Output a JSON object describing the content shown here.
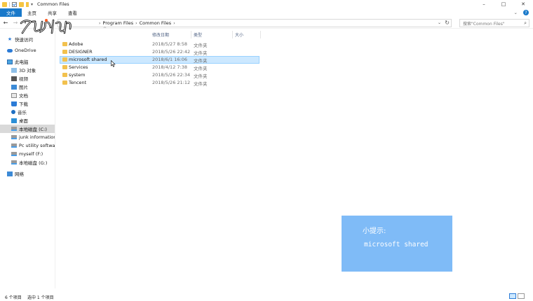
{
  "window": {
    "title": "Common Files",
    "controls": [
      "–",
      "□",
      "✕"
    ]
  },
  "ribbon": {
    "tabs": [
      "文件",
      "主页",
      "共享",
      "查看"
    ]
  },
  "address": {
    "crumbs": [
      "Program Files",
      "Common Files"
    ],
    "search_placeholder": "搜索\"Common Files\""
  },
  "columns": {
    "date": "修改日期",
    "type": "类型",
    "size": "大小"
  },
  "nav": {
    "quick_access": "快速访问",
    "onedrive": "OneDrive",
    "this_pc": "此电脑",
    "objects3d": "3D 对象",
    "videos": "视频",
    "pictures": "图片",
    "documents": "文档",
    "downloads": "下载",
    "music": "音乐",
    "desktop": "桌面",
    "drive_c": "本地磁盘 (C:)",
    "drive_junk": "junk information (",
    "drive_pc": "Pc  utility software",
    "drive_f": "myself (F:)",
    "drive_g": "本地磁盘 (G:)",
    "network": "网络"
  },
  "files": [
    {
      "name": "Adobe",
      "date": "2018/5/27 8:58",
      "type": "文件夹"
    },
    {
      "name": "DESIGNER",
      "date": "2018/5/26 22:42",
      "type": "文件夹"
    },
    {
      "name": "microsoft shared",
      "date": "2018/6/1 16:06",
      "type": "文件夹",
      "selected": true
    },
    {
      "name": "Services",
      "date": "2018/4/12 7:38",
      "type": "文件夹"
    },
    {
      "name": "system",
      "date": "2018/5/26 22:34",
      "type": "文件夹"
    },
    {
      "name": "Tencent",
      "date": "2018/5/26 21:12",
      "type": "文件夹"
    }
  ],
  "status": {
    "count": "6 个项目",
    "selected": "选中 1 个项目"
  },
  "tip": {
    "title": "小提示:",
    "text": "microsoft shared"
  },
  "colors": {
    "accent": "#1979ca",
    "selection": "#cce8ff",
    "tip_bg": "#7fbbf7"
  }
}
